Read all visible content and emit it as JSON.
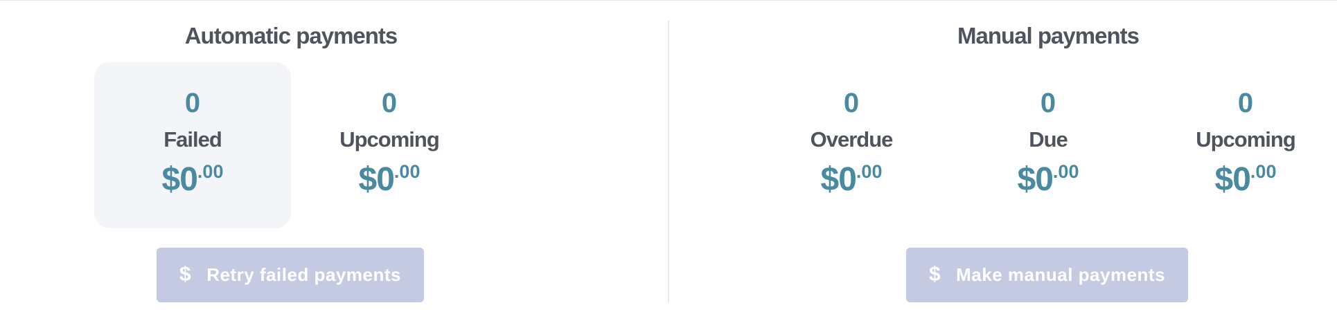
{
  "automatic": {
    "title": "Automatic payments",
    "stats": [
      {
        "count": "0",
        "label": "Failed",
        "amount_major": "$0",
        "amount_minor": ".00",
        "selected": true
      },
      {
        "count": "0",
        "label": "Upcoming",
        "amount_major": "$0",
        "amount_minor": ".00",
        "selected": false
      }
    ],
    "button": {
      "icon": "dollar-icon",
      "icon_glyph": "$",
      "label": "Retry failed payments"
    }
  },
  "manual": {
    "title": "Manual payments",
    "stats": [
      {
        "count": "0",
        "label": "Overdue",
        "amount_major": "$0",
        "amount_minor": ".00"
      },
      {
        "count": "0",
        "label": "Due",
        "amount_major": "$0",
        "amount_minor": ".00"
      },
      {
        "count": "0",
        "label": "Upcoming",
        "amount_major": "$0",
        "amount_minor": ".00"
      }
    ],
    "button": {
      "icon": "dollar-icon",
      "icon_glyph": "$",
      "label": "Make manual payments"
    }
  },
  "colors": {
    "accent": "#4a8aa1",
    "heading": "#4f545c",
    "button_bg": "#c5cae3",
    "selected_bg": "#f3f5f9",
    "divider": "#e6e8ee"
  }
}
